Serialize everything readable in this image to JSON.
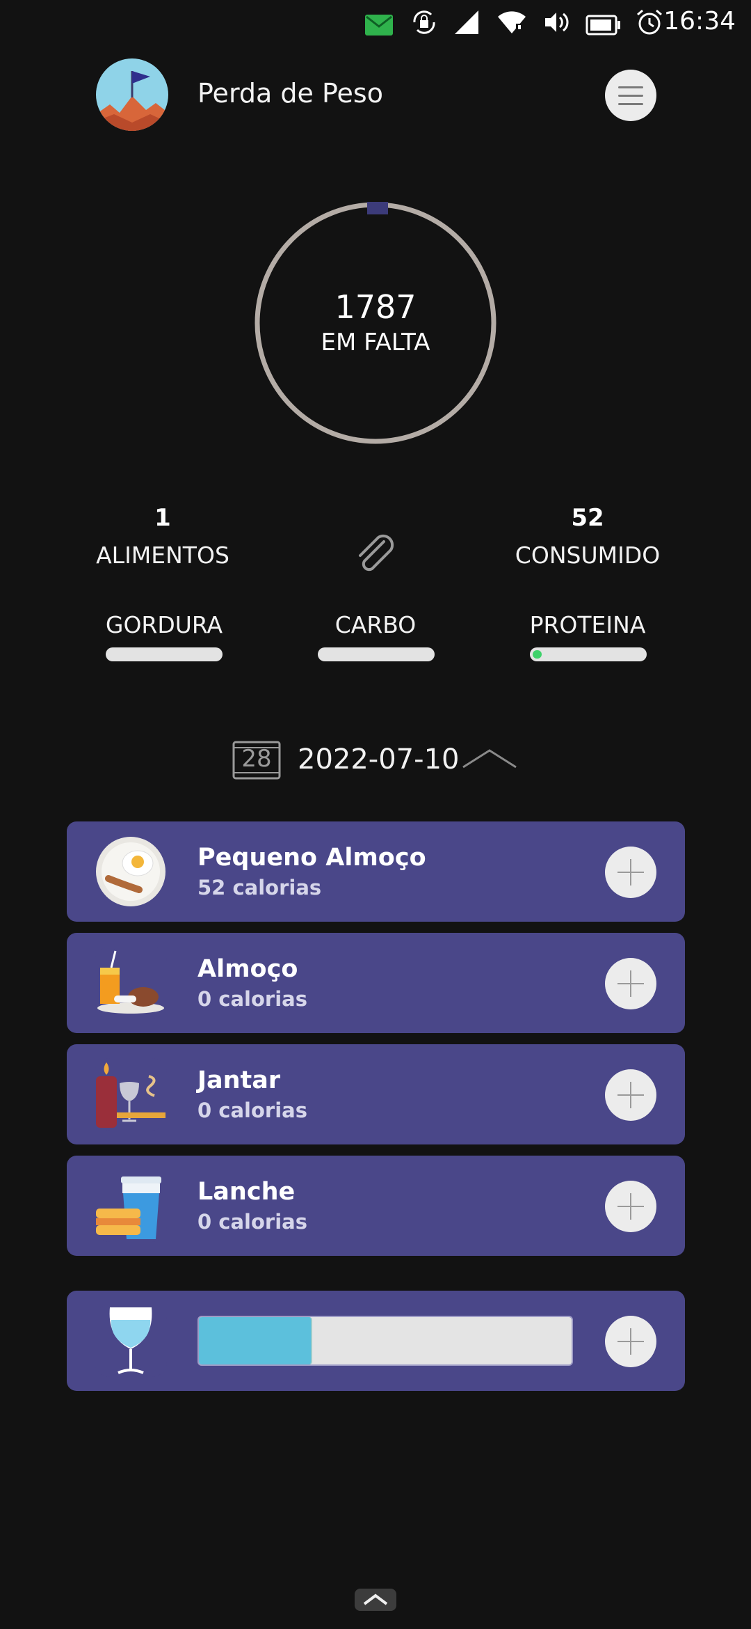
{
  "status_bar": {
    "time": "16:34",
    "icons": [
      "mail-icon",
      "lock-rotation-icon",
      "signal-icon",
      "wifi-icon",
      "volume-icon",
      "battery-icon",
      "alarm-icon"
    ]
  },
  "header": {
    "title": "Perda de Peso",
    "avatar_icon": "mountain-flag-icon",
    "menu_icon": "hamburger-menu-icon"
  },
  "summary": {
    "remaining_value": "1787",
    "remaining_label": "EM FALTA",
    "ring_progress": 0.03
  },
  "stats": {
    "foods_count": "1",
    "foods_label": "ALIMENTOS",
    "consumed_value": "52",
    "consumed_label": "CONSUMIDO",
    "attach_icon": "paperclip-icon"
  },
  "macros": [
    {
      "label": "GORDURA",
      "fraction": 0.0
    },
    {
      "label": "CARBO",
      "fraction": 0.0
    },
    {
      "label": "PROTEINA",
      "fraction": 0.08
    }
  ],
  "date_bar": {
    "calendar_day": "28",
    "date": "2022-07-10"
  },
  "meals": [
    {
      "name": "Pequeno Almoço",
      "calories": "52 calorias",
      "icon": "breakfast-plate-icon"
    },
    {
      "name": "Almoço",
      "calories": "0 calorias",
      "icon": "lunch-tray-icon"
    },
    {
      "name": "Jantar",
      "calories": "0 calorias",
      "icon": "dinner-candle-icon"
    },
    {
      "name": "Lanche",
      "calories": "0 calorias",
      "icon": "snack-cup-icon"
    }
  ],
  "water": {
    "icon": "water-glass-icon",
    "fraction": 0.3
  },
  "colors": {
    "background": "#121212",
    "card": "#4a4789",
    "accent": "#3c3b7a",
    "ring": "#b4aca6",
    "water": "#5cc0dc",
    "protein": "#3ed26a"
  }
}
